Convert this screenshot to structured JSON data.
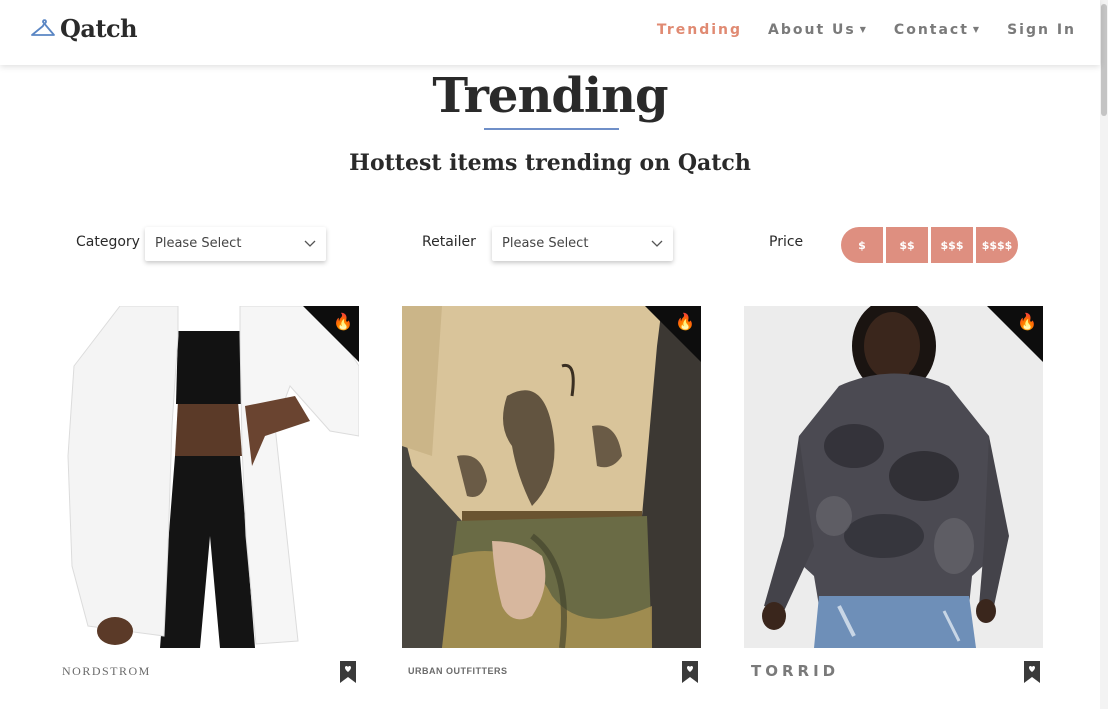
{
  "header": {
    "brand": "Qatch",
    "nav": [
      {
        "label": "Trending",
        "active": true,
        "dropdown": false
      },
      {
        "label": "About Us",
        "active": false,
        "dropdown": true
      },
      {
        "label": "Contact",
        "active": false,
        "dropdown": true
      },
      {
        "label": "Sign In",
        "active": false,
        "dropdown": false
      }
    ]
  },
  "page": {
    "title": "Trending",
    "subtitle": "Hottest items trending on Qatch"
  },
  "filters": {
    "category": {
      "label": "Category",
      "value": "Please Select"
    },
    "retailer": {
      "label": "Retailer",
      "value": "Please Select"
    },
    "price": {
      "label": "Price",
      "options": [
        "$",
        "$$",
        "$$$",
        "$$$$"
      ]
    }
  },
  "products": [
    {
      "retailer": "NORDSTROM",
      "trending": true,
      "saved": false,
      "icon": "fire-icon"
    },
    {
      "retailer": "URBAN OUTFITTERS",
      "trending": true,
      "saved": false,
      "icon": "fire-icon"
    },
    {
      "retailer": "TORRID",
      "trending": true,
      "saved": false,
      "icon": "fire-icon"
    }
  ],
  "colors": {
    "accent": "#e08a72",
    "price_button": "#de8f80",
    "title_underline": "#6f8fc8",
    "badge": "#0d0d0d"
  }
}
